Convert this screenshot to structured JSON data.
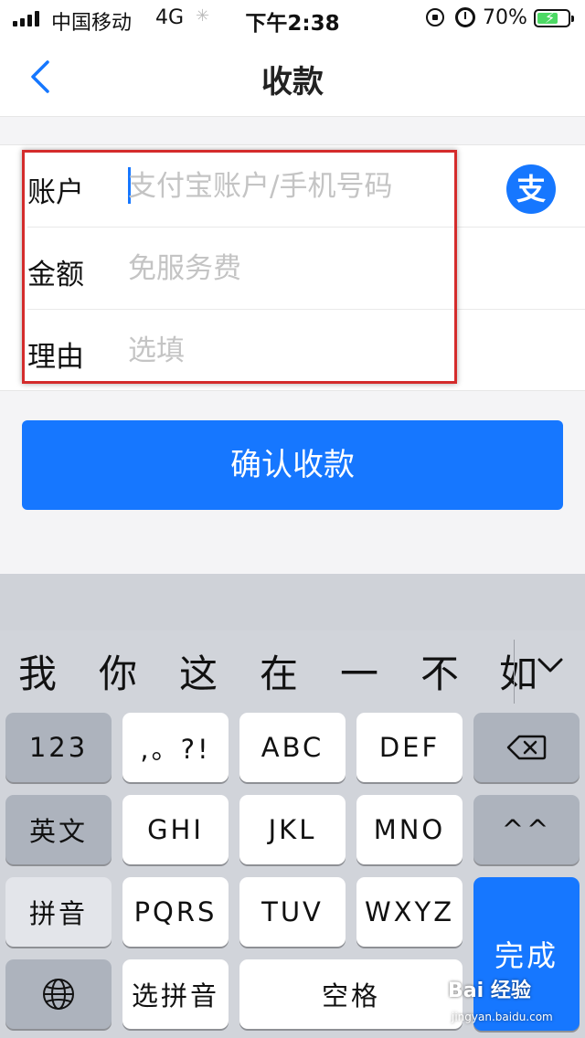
{
  "status_bar": {
    "carrier": "中国移动",
    "network": "4G",
    "time": "下午2:38",
    "battery": "70%",
    "battery_level": 0.7
  },
  "nav": {
    "title": "收款"
  },
  "form": {
    "account_label": "账户",
    "account_placeholder": "支付宝账户/手机号码",
    "amount_label": "金额",
    "amount_placeholder": "免服务费",
    "reason_label": "理由",
    "reason_placeholder": "选填",
    "alipay_icon_glyph": "支"
  },
  "confirm_label": "确认收款",
  "keyboard": {
    "candidates": [
      "我",
      "你",
      "这",
      "在",
      "一",
      "不",
      "如"
    ],
    "row1": [
      "123",
      ",。?!",
      "ABC",
      "DEF"
    ],
    "row2": [
      "英文",
      "GHI",
      "JKL",
      "MNO",
      "^^"
    ],
    "row3": [
      "拼音",
      "PQRS",
      "TUV",
      "WXYZ"
    ],
    "row4_select": "选拼音",
    "row4_space": "空格",
    "done": "完成"
  },
  "watermark": {
    "text": "Bai 经验",
    "url": "jingyan.baidu.com"
  },
  "colors": {
    "accent": "#1677ff",
    "highlight_border": "#d42c2c",
    "battery_green": "#4cd964"
  }
}
